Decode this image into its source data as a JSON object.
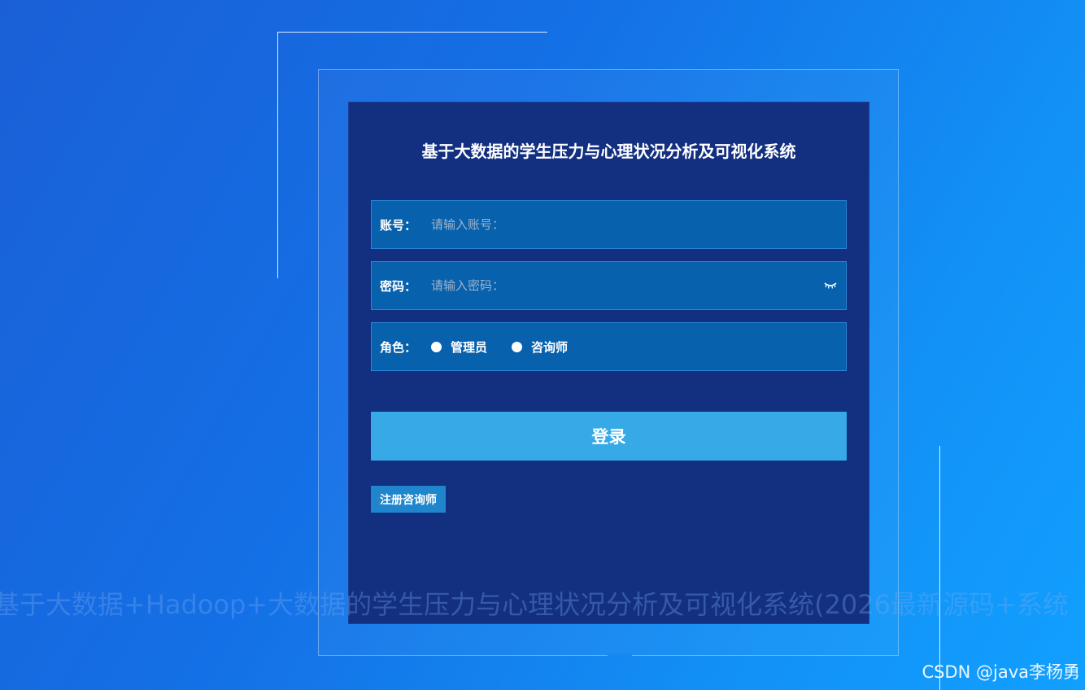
{
  "login": {
    "title": "基于大数据的学生压力与心理状况分析及可视化系统",
    "account": {
      "label": "账号：",
      "placeholder": "请输入账号：",
      "value": ""
    },
    "password": {
      "label": "密码：",
      "placeholder": "请输入密码：",
      "value": ""
    },
    "role": {
      "label": "角色：",
      "options": [
        "管理员",
        "咨询师"
      ]
    },
    "login_button": "登录",
    "register_button": "注册咨询师"
  },
  "watermark": "基于大数据+Hadoop+大数据的学生压力与心理状况分析及可视化系统(2026最新源码+系统",
  "credit": "CSDN @java李杨勇",
  "colors": {
    "background": "#1470e6",
    "panel": "#122f80",
    "field": "#0761ad",
    "login_button": "#36a9e6",
    "register_button": "#1f86cd"
  },
  "icons": {
    "password_toggle": "eye-closed-icon"
  }
}
